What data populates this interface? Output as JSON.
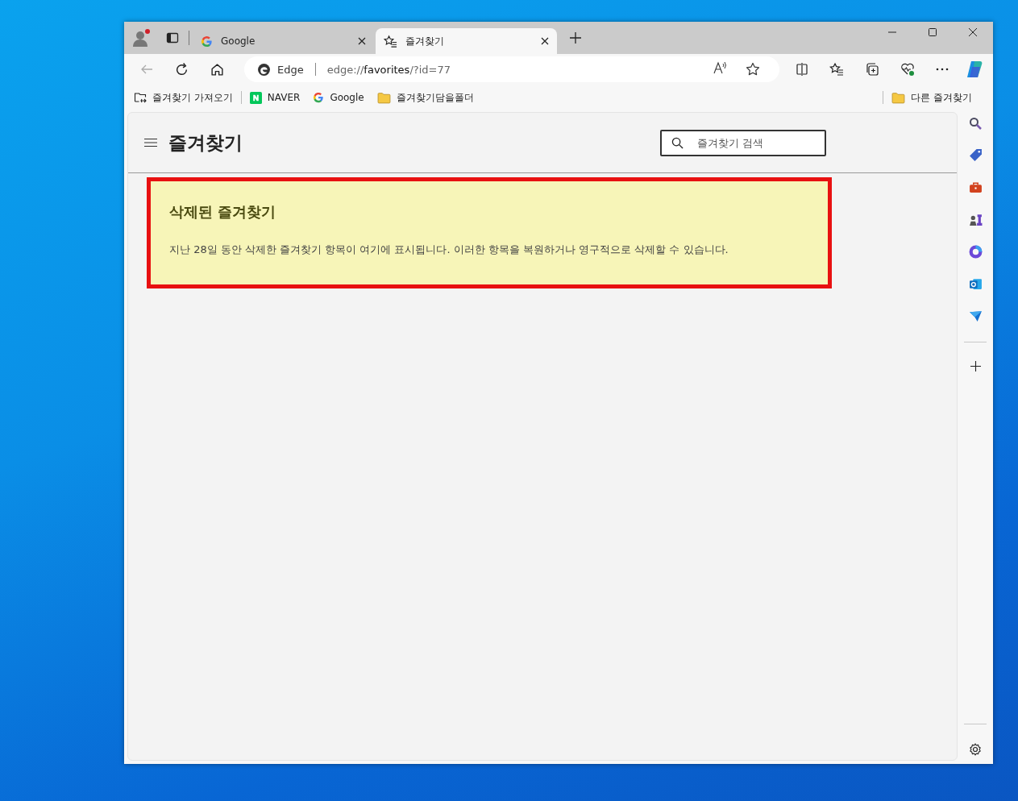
{
  "tabs": [
    {
      "title": "Google",
      "kind": "google",
      "selected": false
    },
    {
      "title": "즐겨찾기",
      "kind": "favorites",
      "selected": true
    }
  ],
  "address_bar": {
    "site_label": "Edge",
    "url_prefix": "edge://",
    "url_host": "favorites",
    "url_rest": "/?id=77"
  },
  "bookmarks": [
    {
      "title": "즐겨찾기 가져오기",
      "kind": "import"
    },
    {
      "title": "NAVER",
      "kind": "naver"
    },
    {
      "title": "Google",
      "kind": "google"
    },
    {
      "title": "즐겨찾기담을폴더",
      "kind": "folder"
    }
  ],
  "other_bookmarks": {
    "title": "다른 즐겨찾기"
  },
  "page": {
    "title": "즐겨찾기",
    "search": {
      "placeholder": "즐겨찾기 검색"
    }
  },
  "notice": {
    "title": "삭제된 즐겨찾기",
    "text": "지난 28일 동안 삭제한 즐겨찾기 항목이 여기에 표시됩니다. 이러한 항목을 복원하거나 영구적으로 삭제할 수 있습니다.",
    "highlighted": true
  }
}
